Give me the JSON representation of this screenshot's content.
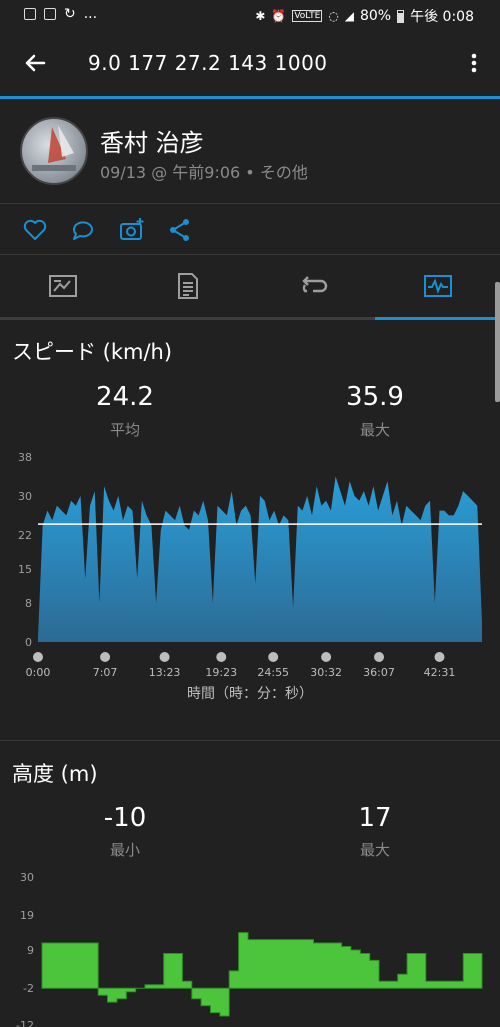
{
  "status_bar": {
    "dots": "...",
    "battery": "80%",
    "time": "午後 0:08",
    "icons": [
      "image-icon",
      "d-icon",
      "sync-icon",
      "bluetooth-icon",
      "alarm-icon",
      "volte-icon",
      "wifi-icon",
      "signal-icon",
      "battery-icon"
    ]
  },
  "app_bar": {
    "title": "9.0 177  27.2  143  1000",
    "back_icon": "arrow-left-icon",
    "menu_icon": "more-vert-icon"
  },
  "profile": {
    "name": "香村 治彦",
    "meta": "09/13 @ 午前9:06 • その他"
  },
  "actions": [
    "like-icon",
    "comment-icon",
    "add-photo-icon",
    "share-icon"
  ],
  "tabs": [
    {
      "icon": "summary-icon",
      "selected": false
    },
    {
      "icon": "details-icon",
      "selected": false
    },
    {
      "icon": "laps-icon",
      "selected": false
    },
    {
      "icon": "charts-icon",
      "selected": true
    }
  ],
  "colors": {
    "accent": "#1a8fd1",
    "speed_fill": "#2a9fd8",
    "elev_fill": "#4cc43c",
    "bg": "#212121"
  },
  "speed": {
    "title": "スピード (km/h)",
    "avg_value": "24.2",
    "avg_label": "平均",
    "max_value": "35.9",
    "max_label": "最大",
    "x_axis_title": "時間（時：分：秒）"
  },
  "elevation": {
    "title": "高度 (m)",
    "min_value": "-10",
    "min_label": "最小",
    "max_value": "17",
    "max_label": "最大"
  },
  "chart_data": [
    {
      "type": "area",
      "title": "スピード (km/h)",
      "xlabel": "時間（時：分：秒）",
      "ylabel": "",
      "ylim": [
        0,
        38
      ],
      "y_ticks": [
        "0",
        "8",
        "15",
        "22",
        "30",
        "38"
      ],
      "x_ticks": [
        "0:00",
        "7:07",
        "13:23",
        "19:23",
        "24:55",
        "30:32",
        "36:07",
        "42:31"
      ],
      "x_tick_minutes": [
        0,
        7.1,
        13.4,
        19.4,
        24.9,
        30.5,
        36.1,
        42.5
      ],
      "reference_line": 24.2,
      "x_minutes": [
        0,
        0.5,
        1,
        1.5,
        2,
        2.5,
        3,
        3.5,
        4,
        4.5,
        5,
        5.5,
        6,
        6.5,
        7,
        7.5,
        8,
        8.5,
        9,
        9.5,
        10,
        10.5,
        11,
        11.5,
        12,
        12.5,
        13,
        13.5,
        14,
        14.5,
        15,
        15.5,
        16,
        16.5,
        17,
        17.5,
        18,
        18.5,
        19,
        19.5,
        20,
        20.5,
        21,
        21.5,
        22,
        22.5,
        23,
        23.5,
        24,
        24.5,
        25,
        25.5,
        26,
        26.5,
        27,
        27.5,
        28,
        28.5,
        29,
        29.5,
        30,
        30.5,
        31,
        31.5,
        32,
        32.5,
        33,
        33.5,
        34,
        34.5,
        35,
        35.5,
        36,
        36.5,
        37,
        37.5,
        38,
        38.5,
        39,
        39.5,
        40,
        40.5,
        41,
        41.5,
        42,
        42.5,
        43,
        43.5,
        44,
        44.5,
        45,
        45.5,
        46,
        46.5,
        47
      ],
      "values": [
        1,
        24,
        27,
        25,
        28,
        27,
        26,
        29,
        28,
        30,
        13,
        28,
        31,
        8,
        32,
        29,
        27,
        30,
        25,
        28,
        27,
        13,
        29,
        26,
        24,
        8,
        23,
        27,
        26,
        25,
        28,
        24,
        23,
        27,
        26,
        29,
        25,
        8,
        28,
        27,
        26,
        31,
        24,
        27,
        28,
        26,
        12,
        30,
        29,
        25,
        27,
        24,
        26,
        25,
        7,
        28,
        27,
        30,
        26,
        32,
        28,
        29,
        27,
        34,
        31,
        28,
        33,
        30,
        29,
        31,
        28,
        32,
        27,
        30,
        33,
        26,
        29,
        24,
        28,
        27,
        26,
        25,
        28,
        29,
        8,
        27,
        27,
        26,
        26,
        28,
        31,
        30,
        29,
        28,
        4
      ]
    },
    {
      "type": "area",
      "title": "高度 (m)",
      "ylim": [
        -12,
        30
      ],
      "y_ticks": [
        "-2",
        "9",
        "19",
        "30"
      ],
      "y_ticks_partial": [
        "-12"
      ],
      "x_minutes": [
        0,
        1,
        2,
        3,
        4,
        5,
        6,
        7,
        8,
        9,
        10,
        11,
        12,
        13,
        14,
        15,
        16,
        17,
        18,
        19,
        20,
        21,
        22,
        23,
        24,
        25,
        26,
        27,
        28,
        29,
        30,
        31,
        32,
        33,
        34,
        35,
        36,
        37,
        38,
        39,
        40,
        41,
        42,
        43,
        44,
        45,
        46,
        47
      ],
      "values": [
        11,
        11,
        11,
        11,
        11,
        11,
        -4,
        -6,
        -5,
        -3,
        -2,
        -1,
        -1,
        8,
        8,
        0,
        -5,
        -7,
        -9,
        -10,
        3,
        14,
        12,
        12,
        12,
        12,
        12,
        12,
        12,
        11,
        11,
        11,
        10,
        9,
        8,
        6,
        0,
        0,
        2,
        8,
        8,
        0,
        0,
        0,
        0,
        8,
        8,
        -2
      ]
    }
  ]
}
